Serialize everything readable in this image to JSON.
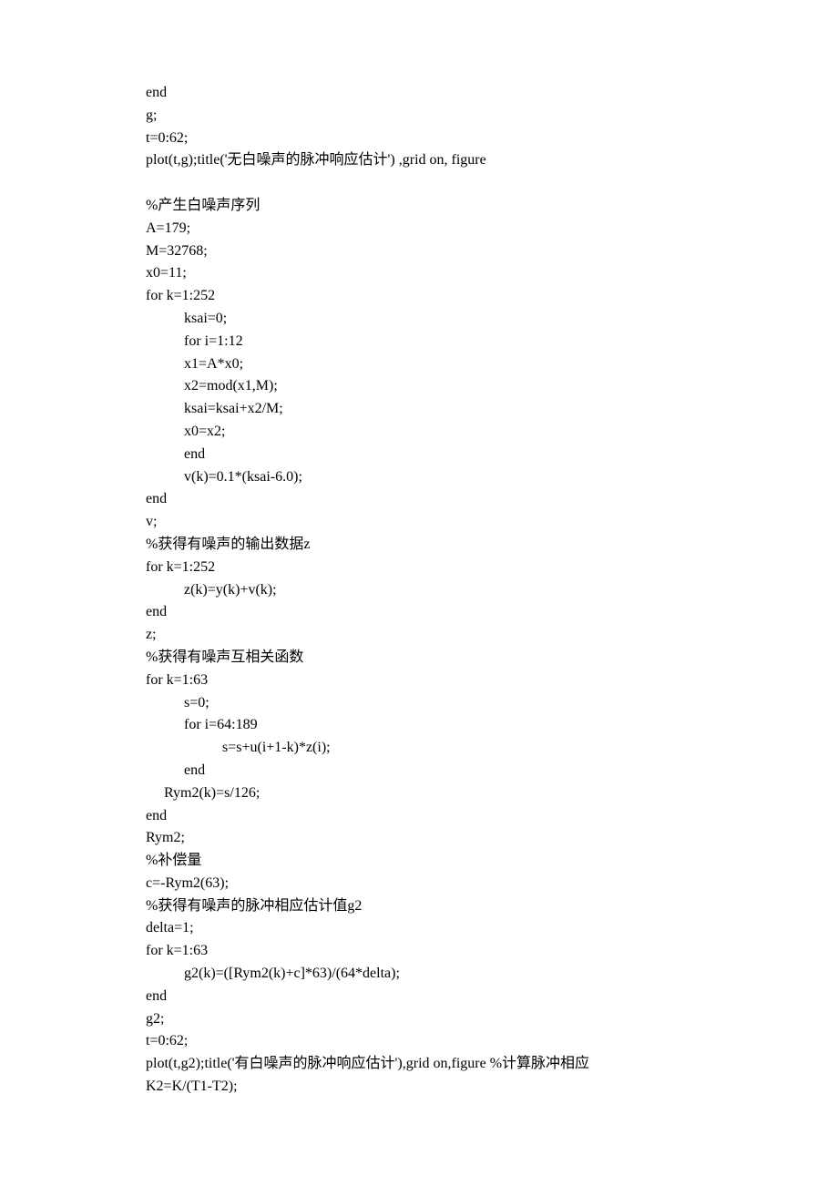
{
  "l": [
    {
      "t": "end",
      "c": ""
    },
    {
      "t": "g;",
      "c": ""
    },
    {
      "t": "t=0:62;",
      "c": ""
    },
    {
      "t": "plot(t,g);title('无白噪声的脉冲响应估计') ,grid on, figure",
      "c": ""
    },
    {
      "t": "",
      "c": ""
    },
    {
      "t": "%产生白噪声序列",
      "c": ""
    },
    {
      "t": "A=179;",
      "c": ""
    },
    {
      "t": "M=32768;",
      "c": ""
    },
    {
      "t": "x0=11;",
      "c": ""
    },
    {
      "t": "for k=1:252",
      "c": ""
    },
    {
      "t": "ksai=0;",
      "c": "i1"
    },
    {
      "t": "for i=1:12",
      "c": "i1"
    },
    {
      "t": "x1=A*x0;",
      "c": "i1"
    },
    {
      "t": "x2=mod(x1,M);",
      "c": "i1"
    },
    {
      "t": "ksai=ksai+x2/M;",
      "c": "i1"
    },
    {
      "t": "x0=x2;",
      "c": "i1"
    },
    {
      "t": "end",
      "c": "i1"
    },
    {
      "t": "v(k)=0.1*(ksai-6.0);",
      "c": "i1"
    },
    {
      "t": "end",
      "c": ""
    },
    {
      "t": "v;",
      "c": ""
    },
    {
      "t": "%获得有噪声的输出数据z",
      "c": ""
    },
    {
      "t": "for k=1:252",
      "c": ""
    },
    {
      "t": "z(k)=y(k)+v(k);",
      "c": "i1"
    },
    {
      "t": "end",
      "c": ""
    },
    {
      "t": "z;",
      "c": ""
    },
    {
      "t": "%获得有噪声互相关函数",
      "c": ""
    },
    {
      "t": "for k=1:63",
      "c": ""
    },
    {
      "t": "s=0;",
      "c": "i1"
    },
    {
      "t": "for i=64:189",
      "c": "i1"
    },
    {
      "t": "s=s+u(i+1-k)*z(i);",
      "c": "i2"
    },
    {
      "t": "end",
      "c": "i1"
    },
    {
      "t": "Rym2(k)=s/126;",
      "c": "i3"
    },
    {
      "t": "end",
      "c": ""
    },
    {
      "t": "Rym2;",
      "c": ""
    },
    {
      "t": "%补偿量",
      "c": ""
    },
    {
      "t": "c=-Rym2(63);",
      "c": ""
    },
    {
      "t": "%获得有噪声的脉冲相应估计值g2",
      "c": ""
    },
    {
      "t": "delta=1;",
      "c": ""
    },
    {
      "t": "for k=1:63",
      "c": ""
    },
    {
      "t": "g2(k)=([Rym2(k)+c]*63)/(64*delta);",
      "c": "i1"
    },
    {
      "t": "end",
      "c": ""
    },
    {
      "t": "g2;",
      "c": ""
    },
    {
      "t": "t=0:62;",
      "c": ""
    },
    {
      "t": "plot(t,g2);title('有白噪声的脉冲响应估计'),grid on,figure %计算脉冲相应",
      "c": ""
    },
    {
      "t": "K2=K/(T1-T2);",
      "c": ""
    }
  ]
}
